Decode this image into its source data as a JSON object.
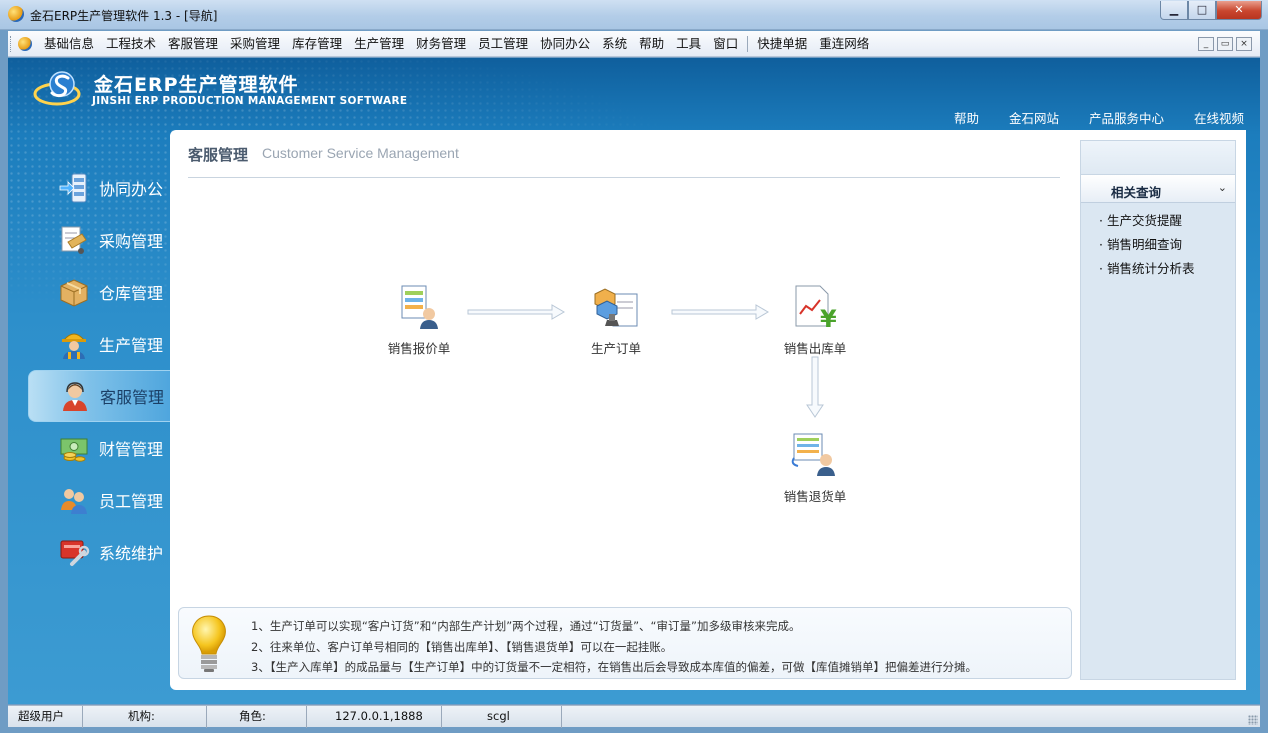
{
  "window": {
    "title": "金石ERP生产管理软件 1.3 - [导航]",
    "buttons": {
      "minimize": "▁",
      "maximize": "□",
      "close": "✕"
    }
  },
  "menubar": {
    "items": [
      "基础信息",
      "工程技术",
      "客服管理",
      "采购管理",
      "库存管理",
      "生产管理",
      "财务管理",
      "员工管理",
      "协同办公",
      "系统",
      "帮助",
      "工具",
      "窗口"
    ],
    "extra_items": [
      "快捷单据",
      "重连网络"
    ],
    "mdi": {
      "minimize": "_",
      "restore": "▭",
      "close": "×"
    }
  },
  "brand": {
    "name_cn": "金石ERP生产管理软件",
    "name_en": "JINSHI ERP PRODUCTION MANAGEMENT SOFTWARE"
  },
  "toplinks": [
    "帮助",
    "金石网站",
    "产品服务中心",
    "在线视频"
  ],
  "sidenav": [
    {
      "label": "协同办公",
      "icon": "collaboration-icon"
    },
    {
      "label": "采购管理",
      "icon": "purchase-icon"
    },
    {
      "label": "仓库管理",
      "icon": "warehouse-box-icon"
    },
    {
      "label": "生产管理",
      "icon": "worker-icon"
    },
    {
      "label": "客服管理",
      "icon": "customer-service-icon",
      "active": true
    },
    {
      "label": "财管管理",
      "icon": "money-icon"
    },
    {
      "label": "员工管理",
      "icon": "employees-icon"
    },
    {
      "label": "系统维护",
      "icon": "system-tools-icon"
    }
  ],
  "content": {
    "title": "客服管理",
    "subtitle": "Customer Service Management",
    "flow": [
      {
        "label": "销售报价单",
        "icon": "quotation-icon"
      },
      {
        "label": "生产订单",
        "icon": "production-order-icon"
      },
      {
        "label": "销售出库单",
        "icon": "sales-outbound-icon"
      },
      {
        "label": "销售退货单",
        "icon": "sales-return-icon"
      }
    ],
    "tips": [
      "1、生产订单可以实现“客户订货”和“内部生产计划”两个过程，通过“订货量”、“审订量”加多级审核来完成。",
      "2、往来单位、客户订单号相同的【销售出库单】、【销售退货单】可以在一起挂账。",
      "3、【生产入库单】的成品量与【生产订单】中的订货量不一定相符，在销售出后会导致成本库值的偏差，可做【库值摊销单】把偏差进行分摊。"
    ]
  },
  "related": {
    "title": "相关查询",
    "items": [
      "生产交货提醒",
      "销售明细查询",
      "销售统计分析表"
    ]
  },
  "statusbar": {
    "user": "超级用户",
    "org_label": "机构:",
    "role_label": "角色:",
    "server": "127.0.0.1,1888",
    "db": "scgl"
  }
}
